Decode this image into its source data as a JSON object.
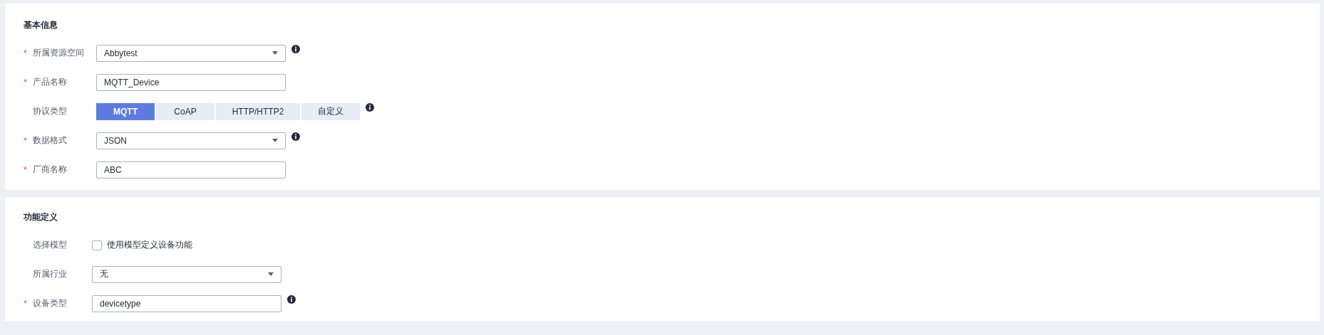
{
  "sections": [
    {
      "title": "基本信息",
      "fields": [
        {
          "kind": "select",
          "marker": "*",
          "label": "所属资源空间",
          "value": "Abbytest",
          "info": true
        },
        {
          "kind": "input",
          "marker": "*",
          "label": "产品名称",
          "value": "MQTT_Device",
          "info": false
        },
        {
          "kind": "segmented",
          "label": "协议类型",
          "info": true,
          "options": [
            {
              "label": "MQTT",
              "selected": true
            },
            {
              "label": "CoAP",
              "selected": false
            },
            {
              "label": "HTTP/HTTP2",
              "selected": false
            },
            {
              "label": "自定义",
              "selected": false
            }
          ]
        },
        {
          "kind": "select",
          "marker": "*",
          "label": "数据格式",
          "value": "JSON",
          "info": true
        },
        {
          "kind": "input",
          "marker": "*",
          "label": "厂商名称",
          "value": "ABC",
          "info": false
        }
      ]
    },
    {
      "title": "功能定义",
      "fields": [
        {
          "kind": "checkbox",
          "label": "选择模型",
          "checked": false,
          "text": "使用模型定义设备功能",
          "info": false
        },
        {
          "kind": "select",
          "label": "所属行业",
          "value": "无",
          "info": false
        },
        {
          "kind": "input",
          "marker": "*",
          "label": "设备类型",
          "value": "devicetype",
          "info": true
        }
      ]
    }
  ]
}
